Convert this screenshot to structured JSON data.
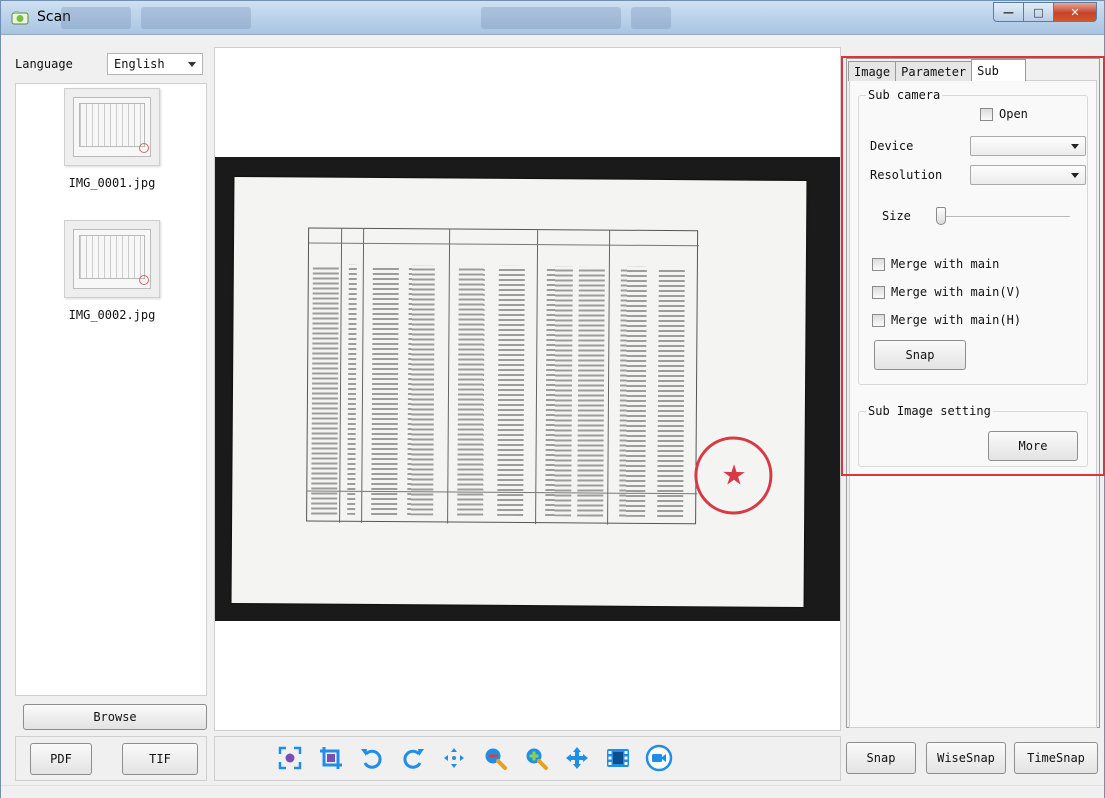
{
  "window": {
    "title": "Scan"
  },
  "left": {
    "language_label": "Language",
    "language_value": "English",
    "thumbnails": [
      {
        "name": "IMG_0001.jpg"
      },
      {
        "name": "IMG_0002.jpg"
      }
    ],
    "browse_label": "Browse"
  },
  "tabs": [
    {
      "label": "Image"
    },
    {
      "label": "Parameter"
    },
    {
      "label": "Sub"
    }
  ],
  "sub": {
    "camera_group": "Sub camera",
    "open_label": "Open",
    "device_label": "Device",
    "resolution_label": "Resolution",
    "size_label": "Size",
    "merge_main": "Merge with main",
    "merge_main_v": "Merge with main(V)",
    "merge_main_h": "Merge with main(H)",
    "snap_label": "Snap",
    "image_setting_group": "Sub Image setting",
    "more_label": "More"
  },
  "bottom": {
    "pdf_label": "PDF",
    "tif_label": "TIF",
    "snap_label": "Snap",
    "wisesnap_label": "WiseSnap",
    "timesnap_label": "TimeSnap"
  },
  "toolbar_icons": [
    "focus-icon",
    "crop-icon",
    "rotate-left-icon",
    "rotate-right-icon",
    "fit-icon",
    "zoom-out-icon",
    "zoom-in-icon",
    "move-icon",
    "film-icon",
    "camera-icon"
  ],
  "colors": {
    "highlight": "#e0323a",
    "icon_blue": "#1f8ee8",
    "icon_purple": "#7a4fb3",
    "icon_red": "#d8403a"
  }
}
